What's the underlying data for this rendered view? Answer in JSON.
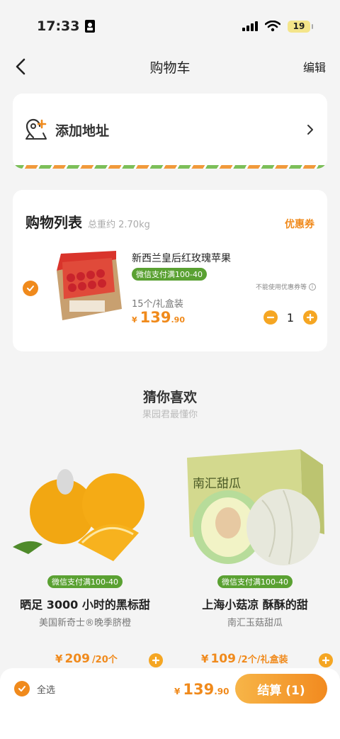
{
  "status_bar": {
    "time": "17:33",
    "battery": "19"
  },
  "nav": {
    "title": "购物车",
    "edit_label": "编辑"
  },
  "address": {
    "label": "添加地址"
  },
  "cart": {
    "title": "购物列表",
    "weight": "总重约 2.70kg",
    "coupon_label": "优惠券",
    "item": {
      "name": "新西兰皇后红玫瑰苹果",
      "promo": "微信支付满100-40",
      "coupon_note": "不能使用优惠券等",
      "spec": "15个/礼盒装",
      "price_symbol": "¥",
      "price_int": "139",
      "price_dec": ".90",
      "quantity": "1"
    }
  },
  "recommend": {
    "title": "猜你喜欢",
    "subtitle": "果园君最懂你",
    "items": [
      {
        "promo": "微信支付满100-40",
        "name": "晒足 3000 小时的黑标甜",
        "subtitle": "美国新奇士®晚季脐橙",
        "price_symbol": "¥",
        "price": "209",
        "unit": "/20个"
      },
      {
        "promo": "微信支付满100-40",
        "name": "上海小菇凉 酥酥的甜",
        "subtitle": "南汇玉菇甜瓜",
        "price_symbol": "¥",
        "price": "109",
        "unit": "/2个/礼盒装",
        "box_text": "南汇甜瓜"
      }
    ]
  },
  "bottom": {
    "select_all": "全选",
    "total_symbol": "¥",
    "total_int": "139",
    "total_dec": ".90",
    "checkout": "结算 (1)"
  },
  "colors": {
    "accent": "#f08a1c",
    "promo_green": "#5aa132"
  }
}
